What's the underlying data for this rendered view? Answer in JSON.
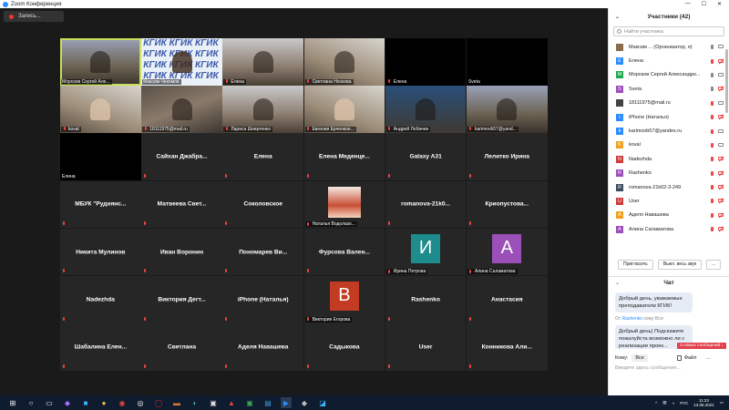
{
  "window": {
    "title": "Zoom Конференция"
  },
  "recording": {
    "label": "Запись..."
  },
  "tiles": [
    {
      "kind": "video",
      "variant": "v2",
      "label": "Морозов Сергей Алe...",
      "active": true,
      "muted": false
    },
    {
      "kind": "kgik",
      "label": "Максим Чекомов",
      "muted": false,
      "kgik": "КГИК КГИК КГИК"
    },
    {
      "kind": "video",
      "variant": "v3",
      "label": "Елена",
      "muted": true
    },
    {
      "kind": "video",
      "variant": "v5",
      "label": "Светлана Носкова",
      "muted": true
    },
    {
      "kind": "dark",
      "label": "Елена",
      "muted": true
    },
    {
      "kind": "dark",
      "label": "Sveta",
      "muted": false
    },
    {
      "kind": "video",
      "variant": "v5",
      "label": "koval",
      "muted": true,
      "light": true
    },
    {
      "kind": "video",
      "variant": "v1",
      "label": "18111975@mail.ru",
      "muted": true
    },
    {
      "kind": "video",
      "variant": "v3",
      "label": "Лариса Шевртенко",
      "muted": true
    },
    {
      "kind": "video",
      "variant": "v5",
      "label": "Евгения Ерченкое...",
      "muted": true,
      "light": true
    },
    {
      "kind": "video",
      "variant": "v4",
      "label": "Андрей Лобачев",
      "muted": true
    },
    {
      "kind": "video",
      "variant": "v2",
      "label": "karimovb57@yand...",
      "muted": true
    },
    {
      "kind": "dark",
      "label": "Елена",
      "muted": false
    },
    {
      "kind": "name",
      "name": "Сайхан Джабра...",
      "muted": true
    },
    {
      "kind": "name",
      "name": "Елена",
      "muted": true
    },
    {
      "kind": "name",
      "name": "Елена Меденце...",
      "muted": true
    },
    {
      "kind": "name",
      "name": "Galaxy A31",
      "muted": true
    },
    {
      "kind": "name",
      "name": "Лелитко Ирина",
      "muted": true
    },
    {
      "kind": "name",
      "name": "МБУК \"Руднянс...",
      "muted": true
    },
    {
      "kind": "name",
      "name": "Матвеева Свет...",
      "muted": true
    },
    {
      "kind": "name",
      "name": "Соколовское",
      "muted": true
    },
    {
      "kind": "photo",
      "label": "Наталья Водолазо...",
      "muted": true
    },
    {
      "kind": "name",
      "name": "romanova-21k0...",
      "muted": true
    },
    {
      "kind": "name",
      "name": "Криопустова...",
      "muted": true
    },
    {
      "kind": "name",
      "name": "Никита Мулинов",
      "muted": true
    },
    {
      "kind": "name",
      "name": "Иван Воронин",
      "muted": true
    },
    {
      "kind": "name",
      "name": "Пономарев Ви...",
      "muted": true
    },
    {
      "kind": "name",
      "name": "Фурсова Вален...",
      "muted": true
    },
    {
      "kind": "letter",
      "letter": "И",
      "color": "#1e8c8c",
      "label": "Ирина Петрова",
      "muted": true
    },
    {
      "kind": "letter",
      "letter": "А",
      "color": "#9b4fb8",
      "label": "Алина Саламатова",
      "muted": true
    },
    {
      "kind": "name",
      "name": "Nadezhda",
      "muted": true
    },
    {
      "kind": "name",
      "name": "Виктория Дегт...",
      "muted": true
    },
    {
      "kind": "name",
      "name": "iPhone (Наталья)",
      "muted": true
    },
    {
      "kind": "letter",
      "letter": "В",
      "color": "#c23b22",
      "label": "Виктория Егорова",
      "muted": true
    },
    {
      "kind": "name",
      "name": "Rashenko",
      "muted": true
    },
    {
      "kind": "name",
      "name": "Анастасия",
      "muted": true
    },
    {
      "kind": "name",
      "name": "Шабалина Елен...",
      "muted": true
    },
    {
      "kind": "name",
      "name": "Светлана",
      "muted": true
    },
    {
      "kind": "name",
      "name": "Аделя Навашева",
      "muted": true
    },
    {
      "kind": "name",
      "name": "Садыкова",
      "muted": true
    },
    {
      "kind": "name",
      "name": "User",
      "muted": true
    },
    {
      "kind": "name",
      "name": "Конникова Али...",
      "muted": true
    }
  ],
  "participants": {
    "title": "Участники (42)",
    "search_placeholder": "Найти участника",
    "items": [
      {
        "name": "Максим ... (Организатор, я)",
        "initial": "",
        "color": "#8a6b4a",
        "mic": "on",
        "video": "on"
      },
      {
        "name": "Елена",
        "initial": "E",
        "color": "#2d8cff",
        "mic": "off",
        "video": "off"
      },
      {
        "name": "Морозов Сергей Александро...",
        "initial": "M",
        "color": "#1fa84f",
        "mic": "on",
        "video": "on"
      },
      {
        "name": "Sveta",
        "initial": "S",
        "color": "#9b4fb8",
        "mic": "on",
        "video": "off"
      },
      {
        "name": "18111975@mail.ru",
        "initial": "",
        "color": "#444",
        "mic": "off",
        "video": "on"
      },
      {
        "name": "iPhone (Наталья)",
        "initial": "i",
        "color": "#2d8cff",
        "mic": "off",
        "video": "off"
      },
      {
        "name": "karimovb57@yandex.ru",
        "initial": "k",
        "color": "#2d8cff",
        "mic": "off",
        "video": "on"
      },
      {
        "name": "koval",
        "initial": "K",
        "color": "#f0a01e",
        "mic": "off",
        "video": "on"
      },
      {
        "name": "Nadezhda",
        "initial": "N",
        "color": "#d23a3a",
        "mic": "off",
        "video": "off"
      },
      {
        "name": "Rashenko",
        "initial": "R",
        "color": "#9b4fb8",
        "mic": "off",
        "video": "off"
      },
      {
        "name": "romanova-21k02-3-249",
        "initial": "R",
        "color": "#3a4b5c",
        "mic": "off",
        "video": "off"
      },
      {
        "name": "User",
        "initial": "U",
        "color": "#d23a3a",
        "mic": "off",
        "video": "off"
      },
      {
        "name": "Аделя Навашева",
        "initial": "A",
        "color": "#f0a01e",
        "mic": "off",
        "video": "off"
      },
      {
        "name": "Алина Саламатова",
        "initial": "A",
        "color": "#9b4fb8",
        "mic": "off",
        "video": "off"
      }
    ],
    "invite_label": "Пригласить",
    "mute_all_label": "Выкл. весь звук",
    "more_label": "..."
  },
  "chat": {
    "title": "Чат",
    "messages": [
      {
        "text": "Добрый день, уважаемые преподаватели КГИК!"
      },
      {
        "from_prefix": "От",
        "from": "Rashenko",
        "to": "кому Все:",
        "text": "Добрый день) Подскажите пожалуйста возможно ли с реализации проек... подавать заявку?"
      }
    ],
    "new_messages": "3 новых сообщений ↓",
    "to_label": "Кому:",
    "to_value": "Все",
    "file_label": "Файл",
    "more": "...",
    "input_placeholder": "Введите здесь сообщение..."
  },
  "taskbar": {
    "lang": "РУС",
    "time": "11:23",
    "date": "13.05.2021"
  }
}
